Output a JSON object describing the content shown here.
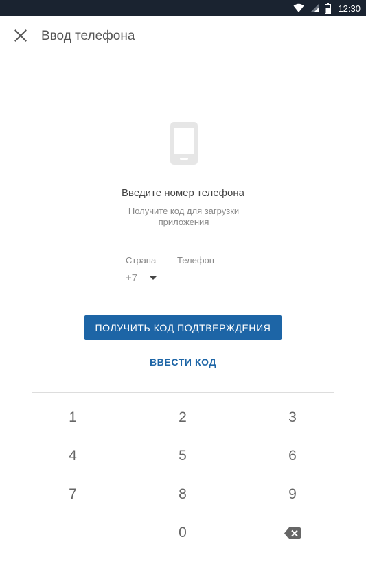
{
  "status_bar": {
    "time": "12:30",
    "icons": [
      "wifi-icon",
      "signal-icon",
      "battery-icon"
    ]
  },
  "app_bar": {
    "close_icon": "close-icon",
    "title": "Ввод телефона"
  },
  "illustration": {
    "icon": "smartphone-icon"
  },
  "heading": "Введите номер телефона",
  "subheading": "Получите код для загрузки приложения",
  "form": {
    "country_label": "Страна",
    "country_value": "+7",
    "phone_label": "Телефон",
    "phone_value": ""
  },
  "actions": {
    "get_code_label": "ПОЛУЧИТЬ КОД ПОДТВЕРЖДЕНИЯ",
    "enter_code_label": "ВВЕСТИ КОД"
  },
  "keypad": {
    "keys": [
      "1",
      "2",
      "3",
      "4",
      "5",
      "6",
      "7",
      "8",
      "9",
      "0"
    ],
    "backspace_icon": "backspace-icon"
  },
  "colors": {
    "status_bar": "#1a2330",
    "accent": "#1d65a6",
    "text_muted": "#888888"
  }
}
